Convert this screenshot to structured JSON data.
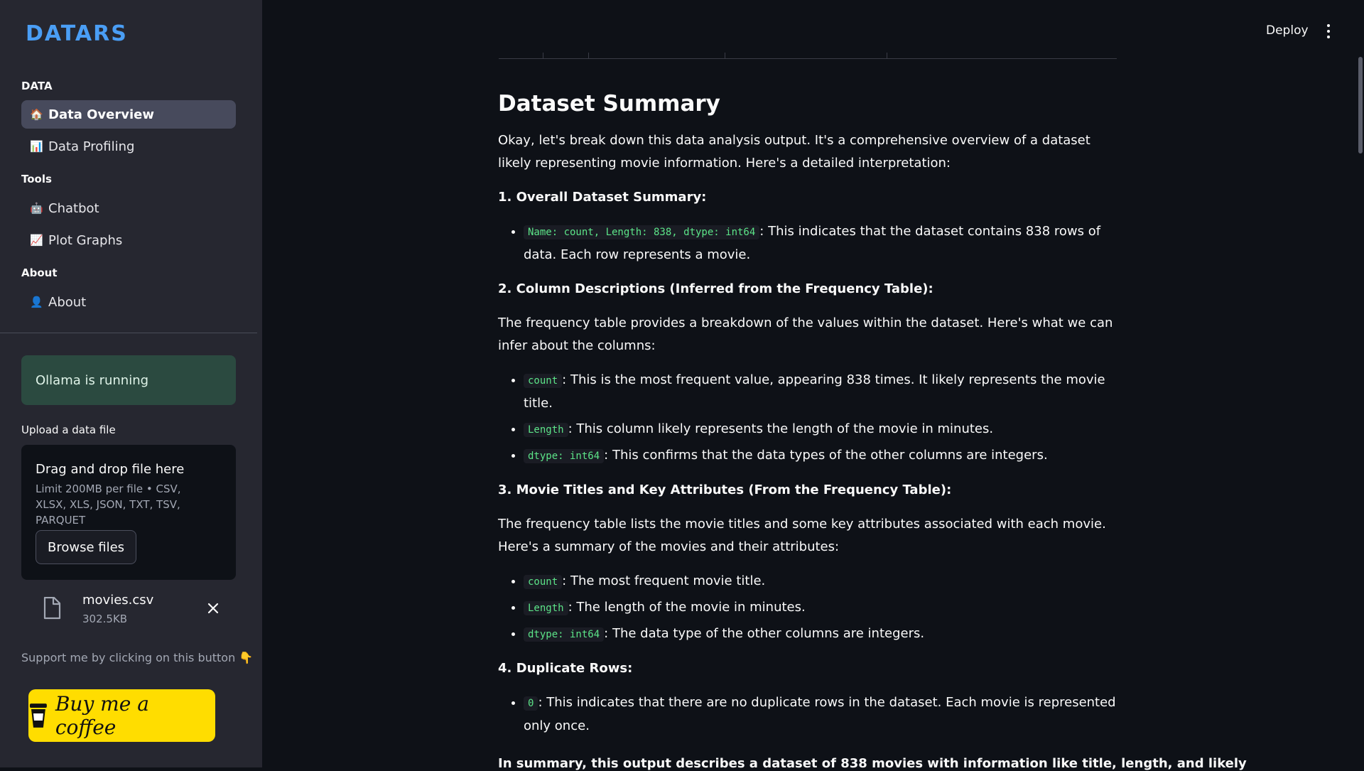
{
  "sidebar": {
    "logo": "DATARS",
    "sections": {
      "data": "DATA",
      "tools": "Tools",
      "about": "About"
    },
    "items": [
      {
        "label": "Data Overview",
        "icon": "house-icon",
        "active": true
      },
      {
        "label": "Data Profiling",
        "icon": "bar-chart-icon",
        "active": false
      },
      {
        "label": "Chatbot",
        "icon": "robot-icon",
        "active": false
      },
      {
        "label": "Plot Graphs",
        "icon": "line-chart-icon",
        "active": false
      },
      {
        "label": "About",
        "icon": "person-icon",
        "active": false
      }
    ],
    "status": "Ollama is running",
    "upload": {
      "label": "Upload a data file",
      "title": "Drag and drop file here",
      "limit": "Limit 200MB per file • CSV, XLSX, XLS, JSON, TXT, TSV, PARQUET",
      "browse": "Browse files"
    },
    "file": {
      "name": "movies.csv",
      "size": "302.5KB"
    },
    "support": "Support me by clicking on this button 👇",
    "coffee": "Buy me a coffee"
  },
  "header": {
    "deploy": "Deploy"
  },
  "main": {
    "title": "Dataset Summary",
    "intro": "Okay, let's break down this data analysis output. It's a comprehensive overview of a dataset likely representing movie information. Here's a detailed interpretation:",
    "s1": {
      "heading": "1. Overall Dataset Summary:",
      "bullets": [
        {
          "code": "Name: count, Length: 838, dtype: int64",
          "text": ": This indicates that the dataset contains 838 rows of data. Each row represents a movie."
        }
      ]
    },
    "s2": {
      "heading": "2. Column Descriptions (Inferred from the Frequency Table):",
      "para": "The frequency table provides a breakdown of the values within the dataset. Here's what we can infer about the columns:",
      "bullets": [
        {
          "code": "count",
          "text": ": This is the most frequent value, appearing 838 times. It likely represents the movie title."
        },
        {
          "code": "Length",
          "text": ": This column likely represents the length of the movie in minutes."
        },
        {
          "code": "dtype: int64",
          "text": ": This confirms that the data types of the other columns are integers."
        }
      ]
    },
    "s3": {
      "heading": "3. Movie Titles and Key Attributes (From the Frequency Table):",
      "para": "The frequency table lists the movie titles and some key attributes associated with each movie. Here's a summary of the movies and their attributes:",
      "bullets": [
        {
          "code": "count",
          "text": ": The most frequent movie title."
        },
        {
          "code": "Length",
          "text": ": The length of the movie in minutes."
        },
        {
          "code": "dtype: int64",
          "text": ": The data type of the other columns are integers."
        }
      ]
    },
    "s4": {
      "heading": "4. Duplicate Rows:",
      "bullets": [
        {
          "code": "0",
          "text": ": This indicates that there are no duplicate rows in the dataset. Each movie is represented only once."
        }
      ]
    },
    "cut_text": "In summary, this output describes a dataset of 838 movies with information like title, length, and likely"
  },
  "colors": {
    "sidebar_bg": "#262730",
    "main_bg": "#0e1117",
    "accent": "#4a9ef5",
    "active_item": "#474a5c",
    "success_bg": "#2b4a40",
    "code_text": "#5ce488",
    "coffee_yellow": "#ffdd00"
  }
}
